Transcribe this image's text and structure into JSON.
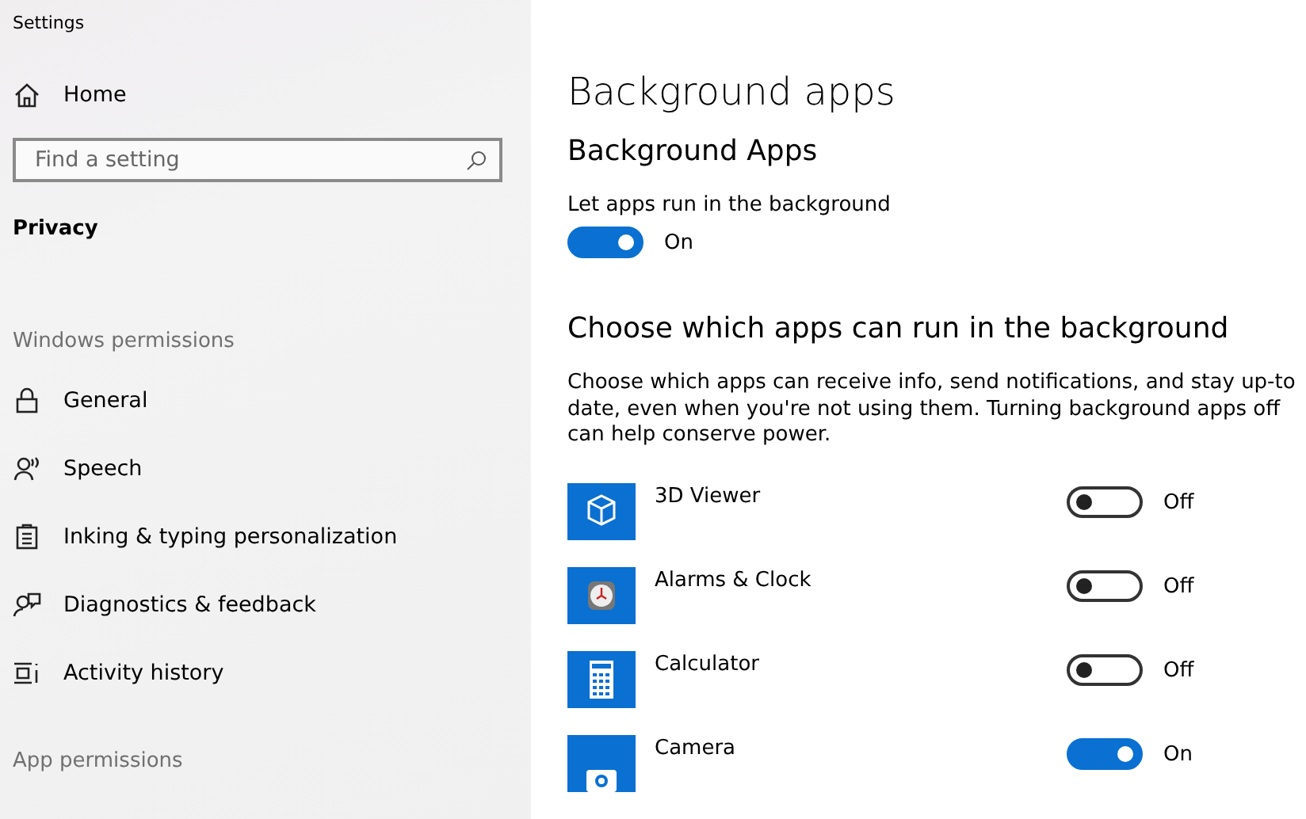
{
  "window": {
    "title": "Settings"
  },
  "sidebar": {
    "home": "Home",
    "search": {
      "placeholder": "Find a setting"
    },
    "section": "Privacy",
    "groups": [
      {
        "heading": "Windows permissions",
        "items": [
          {
            "label": "General"
          },
          {
            "label": "Speech"
          },
          {
            "label": "Inking & typing personalization"
          },
          {
            "label": "Diagnostics & feedback"
          },
          {
            "label": "Activity history"
          }
        ]
      },
      {
        "heading": "App permissions"
      }
    ]
  },
  "main": {
    "title": "Background apps",
    "subtitle": "Background Apps",
    "master": {
      "label": "Let apps run in the background",
      "on": true,
      "state_label": "On"
    },
    "section_title": "Choose which apps can run in the background",
    "description": "Choose which apps can receive info, send notifications, and stay up-to date, even when you're not using them. Turning background apps off can help conserve power.",
    "apps": [
      {
        "name": "3D Viewer",
        "on": false,
        "state_label": "Off"
      },
      {
        "name": "Alarms & Clock",
        "on": false,
        "state_label": "Off"
      },
      {
        "name": "Calculator",
        "on": false,
        "state_label": "Off"
      },
      {
        "name": "Camera",
        "on": true,
        "state_label": "On"
      }
    ]
  }
}
